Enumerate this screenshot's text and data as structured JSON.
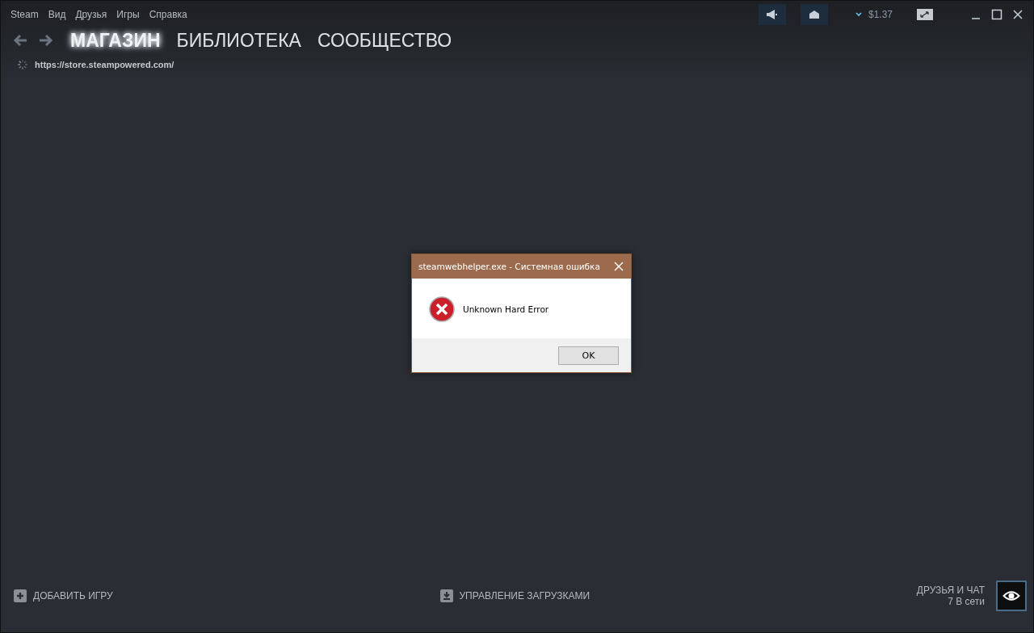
{
  "menu": [
    "Steam",
    "Вид",
    "Друзья",
    "Игры",
    "Справка"
  ],
  "account": {
    "balance": "$1.37"
  },
  "nav_tabs": [
    {
      "label": "МАГАЗИН",
      "selected": true
    },
    {
      "label": "БИБЛИОТЕКА",
      "selected": false
    },
    {
      "label": "СООБЩЕСТВО",
      "selected": false
    }
  ],
  "url": "https://store.steampowered.com/",
  "dialog": {
    "title": "steamwebhelper.exe - Системная ошибка",
    "message": "Unknown Hard Error",
    "button": "OK"
  },
  "footer": {
    "add_game": "ДОБАВИТЬ ИГРУ",
    "downloads": "УПРАВЛЕНИЕ ЗАГРУЗКАМИ",
    "friends": "ДРУЗЬЯ И ЧАТ",
    "online": "7 В сети"
  }
}
